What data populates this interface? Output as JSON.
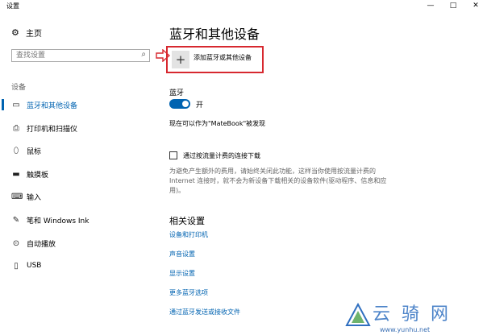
{
  "window": {
    "title": "设置",
    "minimize_glyph": "—",
    "maximize_glyph": "□",
    "close_glyph": "✕"
  },
  "sidebar": {
    "home_label": "主页",
    "search_placeholder": "查找设置",
    "section_label": "设备",
    "items": [
      {
        "label": "蓝牙和其他设备",
        "icon": "bluetooth-icon"
      },
      {
        "label": "打印机和扫描仪",
        "icon": "printer-icon"
      },
      {
        "label": "鼠标",
        "icon": "mouse-icon"
      },
      {
        "label": "触摸板",
        "icon": "touchpad-icon"
      },
      {
        "label": "输入",
        "icon": "keyboard-icon"
      },
      {
        "label": "笔和 Windows Ink",
        "icon": "pen-icon"
      },
      {
        "label": "自动播放",
        "icon": "autoplay-icon"
      },
      {
        "label": "USB",
        "icon": "usb-icon"
      }
    ]
  },
  "main": {
    "page_title": "蓝牙和其他设备",
    "add_device_label": "添加蓝牙或其他设备",
    "bluetooth_label": "蓝牙",
    "toggle_state": "开",
    "discoverable_text": "现在可以作为\"MateBook\"被发现",
    "metered_label": "通过按流量计费的连接下载",
    "metered_description": "为避免产生额外的费用，请始终关闭此功能，这样当你使用按流量计费的 Internet 连接时，就不会为新设备下载相关的设备软件(驱动程序、信息和应用)。",
    "related_title": "相关设置",
    "related_links": [
      "设备和打印机",
      "声音设置",
      "显示设置",
      "更多蓝牙选项",
      "通过蓝牙发送或接收文件"
    ]
  },
  "watermark": {
    "brand": "云骑网",
    "url": "www.yunhu.net"
  },
  "colors": {
    "accent": "#0063b1",
    "highlight_border": "#d7282f"
  }
}
